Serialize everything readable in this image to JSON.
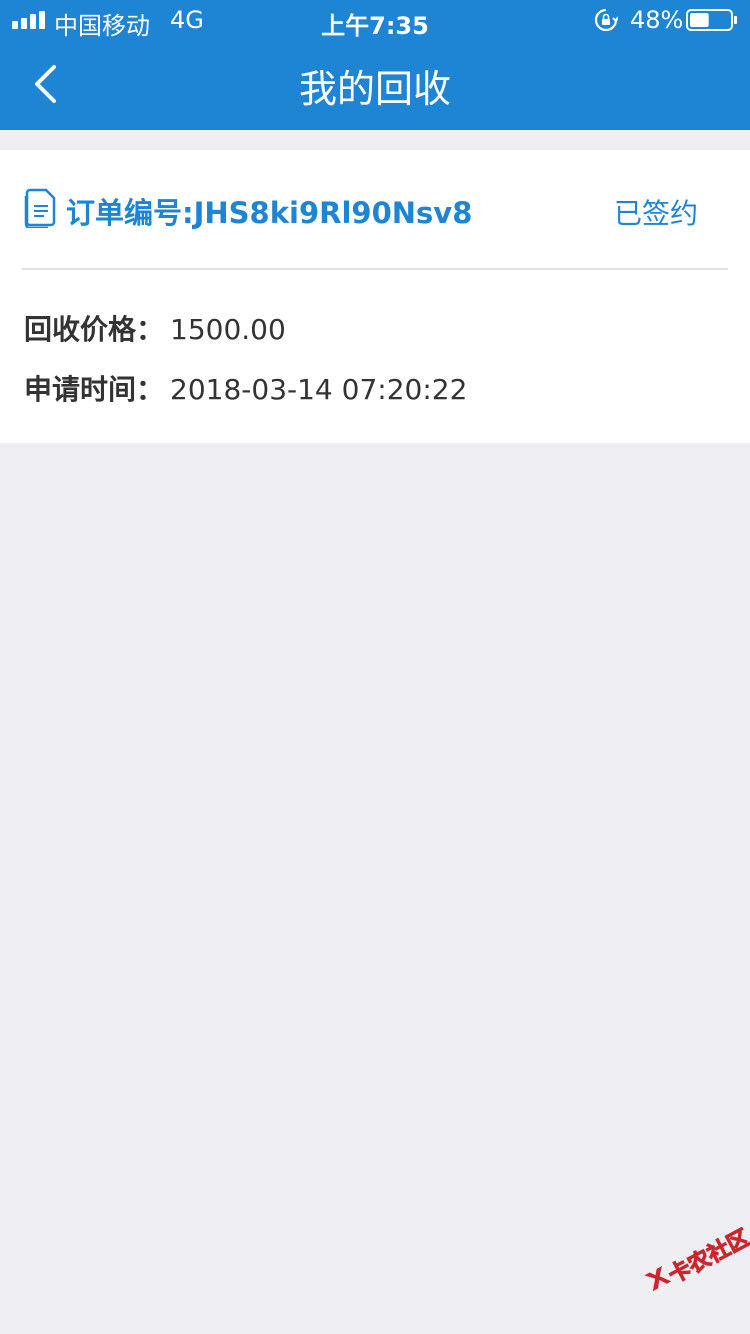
{
  "status_bar": {
    "carrier": "中国移动",
    "network": "4G",
    "time": "上午7:35",
    "battery_percent": "48%",
    "battery_level": 0.48,
    "icons": [
      "signal-icon",
      "orientation-lock-icon",
      "battery-icon"
    ]
  },
  "nav": {
    "title": "我的回收",
    "back_icon": "chevron-left-icon"
  },
  "order": {
    "icon": "document-icon",
    "number_text": "订单编号:JHS8ki9Rl90Nsv8",
    "status": "已签约",
    "fields": [
      {
        "label": "回收价格：",
        "value": "1500.00"
      },
      {
        "label": "申请时间：",
        "value": "2018-03-14 07:20:22"
      }
    ]
  },
  "watermark": {
    "text": "卡农社区"
  },
  "colors": {
    "primary": "#1e84d4",
    "background": "#eeeef3",
    "card": "#ffffff",
    "text": "#333333",
    "watermark": "#c8282d"
  }
}
